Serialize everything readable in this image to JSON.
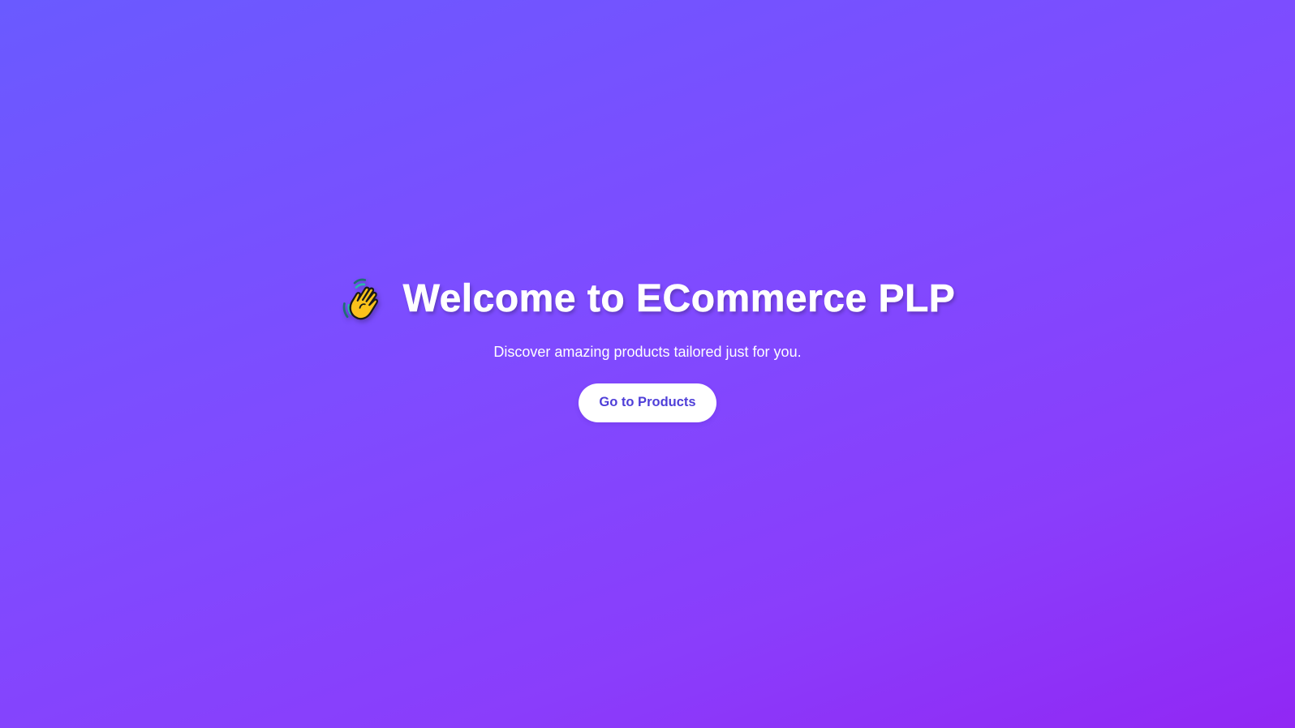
{
  "hero": {
    "icon": "waving-hand-icon",
    "title": "Welcome to ECommerce PLP",
    "subtitle": "Discover amazing products tailored just for you.",
    "cta_label": "Go to Products"
  },
  "colors": {
    "background_start": "#6a5aff",
    "background_end": "#9127f4",
    "title_text": "#ffffff",
    "button_bg": "#ffffff",
    "button_text": "#4f3fd8"
  }
}
